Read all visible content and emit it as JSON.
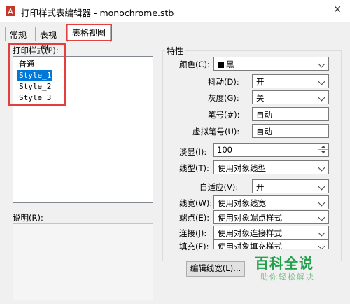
{
  "window": {
    "title": "打印样式表编辑器 - monochrome.stb",
    "close_glyph": "✕"
  },
  "tabs": [
    {
      "label": "常规"
    },
    {
      "label": "表视图"
    },
    {
      "label": "表格视图"
    }
  ],
  "styles_panel": {
    "label": "打印样式(P):",
    "items": [
      "普通",
      "Style_1",
      "Style_2",
      "Style_3"
    ],
    "selected_index": 1
  },
  "description": {
    "label": "说明(R):"
  },
  "properties": {
    "group_title": "特性",
    "color": {
      "label": "颜色(C):",
      "value": "黑",
      "swatch_color": "#000000"
    },
    "dither": {
      "label": "抖动(D):",
      "value": "开"
    },
    "grayscale": {
      "label": "灰度(G):",
      "value": "关"
    },
    "pen_number": {
      "label": "笔号(#):",
      "value": "自动"
    },
    "virtual_pen": {
      "label": "虚拟笔号(U):",
      "value": "自动"
    },
    "screening": {
      "label": "淡显(I):",
      "value": "100"
    },
    "linetype": {
      "label": "线型(T):",
      "value": "使用对象线型"
    },
    "adaptive": {
      "label": "自适应(V):",
      "value": "开"
    },
    "lineweight": {
      "label": "线宽(W):",
      "value": "使用对象线宽"
    },
    "line_end": {
      "label": "端点(E):",
      "value": "使用对象端点样式"
    },
    "line_join": {
      "label": "连接(J):",
      "value": "使用对象连接样式"
    },
    "fill": {
      "label": "填充(F):",
      "value": "使用对象填充样式"
    }
  },
  "buttons": {
    "edit_lineweights": "编辑线宽(L)..."
  },
  "watermark": {
    "main": "百科全说",
    "sub": "助你轻松解决"
  },
  "colors": {
    "highlight_red": "#e2403e",
    "selection_blue": "#0078d7",
    "watermark_green": "#22a04b"
  }
}
